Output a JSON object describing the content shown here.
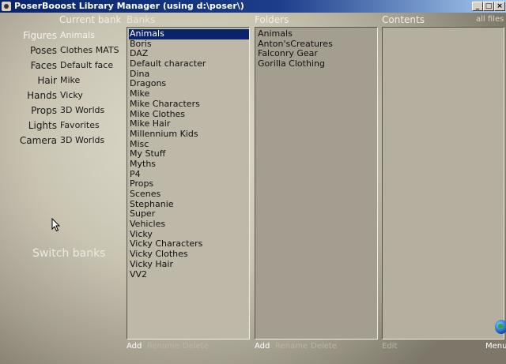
{
  "window": {
    "title": "PoserBooost Library Manager (using d:\\poser\\)"
  },
  "headers": {
    "current_bank": "Current bank",
    "banks": "Banks",
    "folders": "Folders",
    "contents": "Contents",
    "all_files": "all files"
  },
  "categories": [
    {
      "name": "Figures",
      "value": "Animals"
    },
    {
      "name": "Poses",
      "value": "Clothes MATS"
    },
    {
      "name": "Faces",
      "value": "Default face"
    },
    {
      "name": "Hair",
      "value": "Mike"
    },
    {
      "name": "Hands",
      "value": "Vicky"
    },
    {
      "name": "Props",
      "value": "3D Worlds"
    },
    {
      "name": "Lights",
      "value": "Favorites"
    },
    {
      "name": "Camera",
      "value": "3D Worlds"
    }
  ],
  "switch_banks": "Switch banks",
  "banks": [
    "Animals",
    "Boris",
    "DAZ",
    "Default character",
    "Dina",
    "Dragons",
    "Mike",
    "Mike Characters",
    "Mike Clothes",
    "Mike Hair",
    "Millennium Kids",
    "Misc",
    "My Stuff",
    "Myths",
    "P4",
    "Props",
    "Scenes",
    "Stephanie",
    "Super",
    "Vehicles",
    "Vicky",
    "Vicky Characters",
    "Vicky Clothes",
    "Vicky Hair",
    "VV2"
  ],
  "folders": [
    "Animals",
    "Anton'sCreatures",
    "Falconry Gear",
    "Gorilla Clothing"
  ],
  "actions": {
    "add": "Add",
    "rename": "Rename",
    "delete": "Delete",
    "edit": "Edit",
    "menu": "Menu"
  }
}
